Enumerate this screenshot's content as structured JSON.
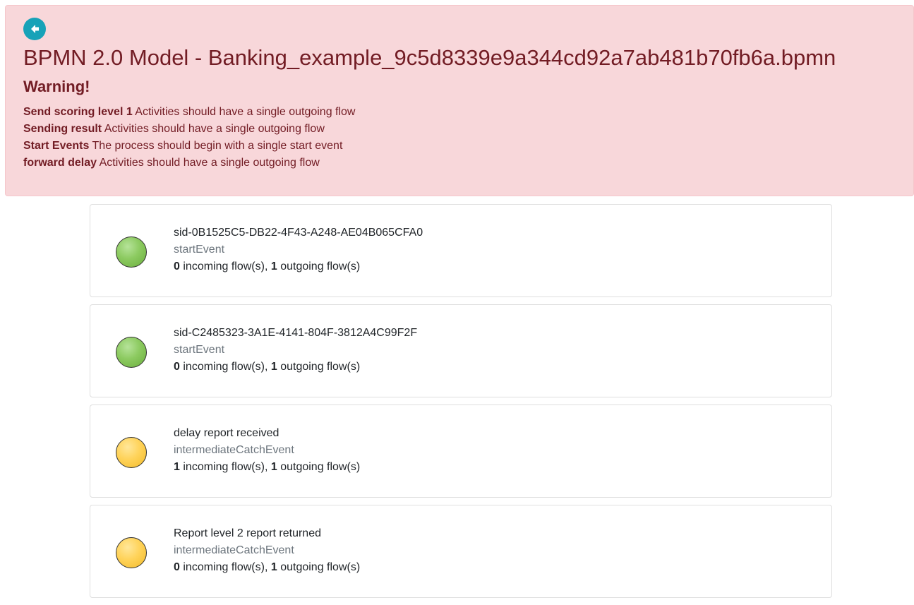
{
  "header": {
    "title": "BPMN 2.0 Model - Banking_example_9c5d8339e9a344cd92a7ab481b70fb6a.bpmn",
    "warning_heading": "Warning!",
    "warnings": [
      {
        "subject": "Send scoring level 1",
        "message": "Activities should have a single outgoing flow"
      },
      {
        "subject": "Sending result",
        "message": "Activities should have a single outgoing flow"
      },
      {
        "subject": "Start Events",
        "message": "The process should begin with a single start event"
      },
      {
        "subject": "forward delay",
        "message": "Activities should have a single outgoing flow"
      }
    ]
  },
  "flow_labels": {
    "incoming": "incoming flow(s),",
    "outgoing": "outgoing flow(s)"
  },
  "elements": [
    {
      "name": "sid-0B1525C5-DB22-4F43-A248-AE04B065CFA0",
      "type": "startEvent",
      "incoming": "0",
      "outgoing": "1",
      "color": "#8cca60"
    },
    {
      "name": "sid-C2485323-3A1E-4141-804F-3812A4C99F2F",
      "type": "startEvent",
      "incoming": "0",
      "outgoing": "1",
      "color": "#8cca60"
    },
    {
      "name": "delay report received",
      "type": "intermediateCatchEvent",
      "incoming": "1",
      "outgoing": "1",
      "color": "#ffd35a"
    },
    {
      "name": "Report level 2 report returned",
      "type": "intermediateCatchEvent",
      "incoming": "0",
      "outgoing": "1",
      "color": "#ffd35a"
    }
  ],
  "icons": {
    "back": "arrow-left-circle-icon"
  },
  "colors": {
    "alert_bg": "#f8d7da",
    "alert_text": "#721c24",
    "back_button": "#17a2b8"
  }
}
